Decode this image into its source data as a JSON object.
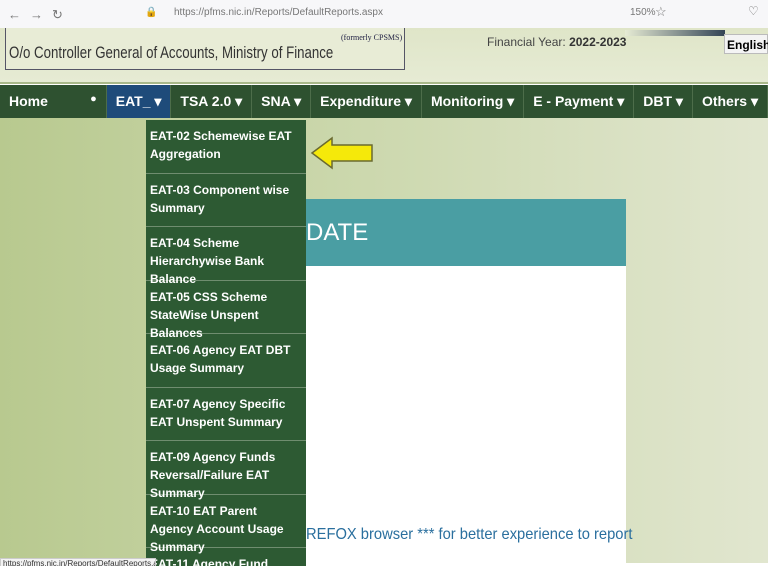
{
  "browser": {
    "url": "https://pfms.nic.in/Reports/DefaultReports.aspx",
    "zoom": "150%"
  },
  "header": {
    "org": "O/o Controller General of Accounts, Ministry of Finance",
    "formerly": "(formerly CPSMS)",
    "fy_label": "Financial Year:",
    "fy_value": "2022-2023",
    "language": "English"
  },
  "nav": [
    "Home",
    "EAT_ ▾",
    "TSA 2.0 ▾",
    "SNA ▾",
    "Expenditure ▾",
    "Monitoring ▾",
    "E - Payment ▾",
    "DBT ▾",
    "Others ▾"
  ],
  "menu": [
    "EAT-02 Schemewise EAT Aggregation",
    "EAT-03 Component wise Summary",
    "EAT-04 Scheme Hierarchywise Bank Balance",
    "EAT-05 CSS Scheme StateWise Unspent Balances",
    "EAT-06 Agency EAT DBT Usage Summary",
    "EAT-07 Agency Specific EAT Unspent Summary",
    "EAT-09 Agency Funds Reversal/Failure EAT Summary",
    "EAT-10 EAT Parent Agency Account Usage Summary",
    "EAT-11 Agency Fund"
  ],
  "panel": {
    "title": "DATE",
    "notice": "REFOX browser *** for better experience to report"
  },
  "status_url": "https://pfms.nic.in/Reports/DefaultReports.aspx#",
  "colors": {
    "nav": "#2e5130",
    "active": "#1e4b7a",
    "panel": "#4a9ea3",
    "arrow": "#f5e90a"
  }
}
